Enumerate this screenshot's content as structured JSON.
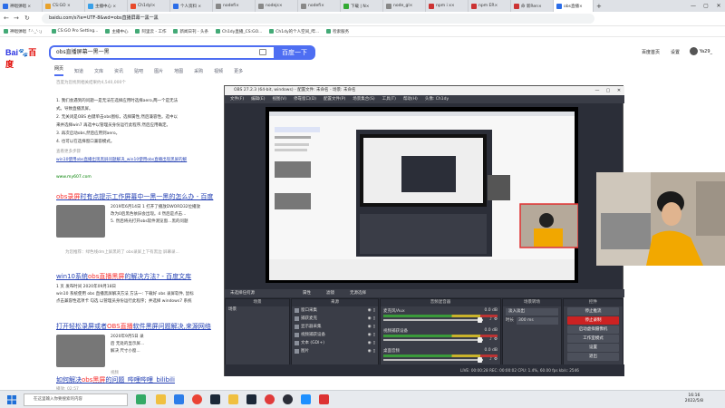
{
  "browser": {
    "tabs": [
      {
        "label": "神唱弹唱 ×",
        "color": "#2b6de8"
      },
      {
        "label": "CS:GO ×",
        "color": "#e8a22b"
      },
      {
        "label": "主播中心 ×",
        "color": "#3aa0e8"
      },
      {
        "label": "Ch1dyl×",
        "color": "#e84a2b"
      },
      {
        "label": "个人资料 ×",
        "color": "#2b6de8"
      },
      {
        "label": "nodefi×",
        "color": "#888"
      },
      {
        "label": "nodejs×",
        "color": "#888"
      },
      {
        "label": "nodefi×",
        "color": "#888"
      },
      {
        "label": "下载 | N×",
        "color": "#3a3"
      },
      {
        "label": "node_gl×",
        "color": "#888"
      },
      {
        "label": "npm i x×",
        "color": "#c33"
      },
      {
        "label": "npm ER×",
        "color": "#c33"
      },
      {
        "label": "命 新Ren×",
        "color": "#c33"
      },
      {
        "label": "obs直播×",
        "color": "#2b6de8"
      }
    ],
    "window_controls": [
      "—",
      "▢",
      "✕"
    ],
    "url": "baidu.com/s?ie=UTF-8&wd=obs直播屏幕一黑一黑",
    "bookmarks": [
      "神唱弹唱「·'·_'·:」",
      "CS:GO Pro Setting...",
      "主播中心",
      "阿里云 - 工作",
      "新闻日刊 - 头条",
      "Ch1dy直播_CS:GO...",
      "Ch1dy的个人空间_哔...",
      "检索服务"
    ]
  },
  "baidu": {
    "logo_left": "Bai",
    "logo_right": "百度",
    "query": "obs直播屏幕一黑一黑",
    "search_button": "百度一下",
    "header_links": [
      "百度首页",
      "设置"
    ],
    "user_name": "Ya29_",
    "tabs": [
      "网页",
      "知道",
      "文库",
      "资讯",
      "贴吧",
      "图片",
      "地图",
      "采购",
      "视频",
      "更多"
    ],
    "result_count": "百度为您找到相关结果约4,540,000个",
    "answer_lines": [
      "1. 我们会遇到的问题一是无法在选择应用时选择aero,两一个是无法",
      "式。导致直播黑屏。",
      "2. 无关闭是OBS 右键单击obs图标，选择属性,然后兼容性。选中以",
      "来并选择win7 再选中以管理员身份运行此程序,然后应用确定。",
      "3. 再次启动obs,然后应用到aero。",
      "4. 也可以在选择窗口兼容模式。"
    ],
    "answer_more": "查看更多步骤",
    "answer_link": "win10使用obs直播出现黑屏问题解决_win10使用obs直播出现黑屏的解",
    "answer_source": "www.my607.com",
    "results": [
      {
        "title_pre": "",
        "title_em": "obs录屏",
        "title_post": "时有点提示工作屏幕中一黑一黑的怎么办 - 百度",
        "snippet": [
          "2019年6月14日 1 打开了播放DWORD32位播放",
          "改为0后黑色依旧会出现。4 然后是点击...",
          "5. 然后将光打开obs软件测览窗...黑的问题"
        ],
        "meta": "为您推荐：绿色线dm上屏黑的了  obs录屏上下有黑边  屏幕录..."
      },
      {
        "title_pre": "win10系统",
        "title_em": "obs直播黑屏",
        "title_post": "的解决方法? - 百度文库",
        "snippet": [
          "1 页 发布时间 2020年09月18日",
          "win10 系统使用 obs 直播黑屏解决方法 方法一: 下载好 obs 录屏软件, 鼠标",
          "点击兼容性选项卡 勾选 以管理员身份运行此程序；并选择 windows7 系统"
        ],
        "meta": ""
      },
      {
        "title_pre": "打开轻松录屏或者",
        "title_em": "OBS直播",
        "title_post": "软件黑屏问题解决,来源网络",
        "snippet": [
          "2020年9月5日 录",
          "后 无处的显示屏...",
          "解决 尺寸小窗..."
        ],
        "meta": "视频"
      },
      {
        "title_pre": "如何解决",
        "title_em": "obs黑屏",
        "title_post": "的问题_哔哩哔哩_bilibili",
        "snippet": [],
        "meta": "播放: 02:57"
      }
    ]
  },
  "obs": {
    "title": "OBS 27.2.3 (64-bit, windows) - 配置文件: 未命名 - 场景: 未命名",
    "menu": [
      "文件(F)",
      "编辑(E)",
      "视图(V)",
      "停靠窗口(D)",
      "配置文件(P)",
      "场景集合(S)",
      "工具(T)",
      "帮助(H)",
      "头像: Ch1dy"
    ],
    "source_bar": [
      "未选择任何源",
      "属性",
      "滤镜",
      "无源选择"
    ],
    "docks": {
      "scenes": {
        "title": "场景",
        "items": [
          "场景"
        ]
      },
      "sources": {
        "title": "来源",
        "items": [
          "窗口采集",
          "捕获麦克",
          "显示器采集",
          "视频捕获设备",
          "文本 (GDI+)",
          "图片"
        ]
      },
      "mixer": {
        "title": "音频混音器",
        "items": [
          {
            "name": "麦克风/Aux",
            "db": "0.0 dB"
          },
          {
            "name": "视频捕获设备",
            "db": "0.0 dB"
          },
          {
            "name": "桌面音频",
            "db": "0.0 dB"
          }
        ]
      },
      "transitions": {
        "title": "场景转场",
        "type": "淡入淡出",
        "duration_label": "时长",
        "duration": "300 ms"
      },
      "controls": {
        "title": "控件",
        "buttons": [
          "停止推流",
          "停止录制",
          "启动虚拟摄像机",
          "工作室模式",
          "设置",
          "退出"
        ]
      }
    },
    "status": "LIVE: 00:00:28  REC: 00:00:02  CPU: 1.4%, 60.00 fps  kb/s: 2546"
  },
  "taskbar": {
    "search_placeholder": "在这里输入你要搜索的内容",
    "time": "16:16",
    "date": "2022/5/8"
  }
}
